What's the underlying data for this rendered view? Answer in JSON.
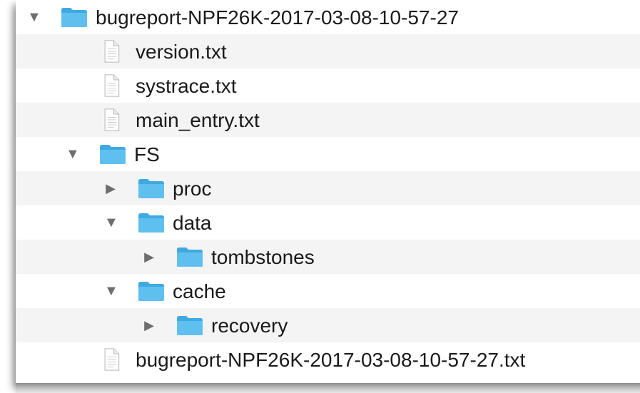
{
  "tree": {
    "root": {
      "label": "bugreport-NPF26K-2017-03-08-10-57-27",
      "icon": "folder-icon",
      "state": "expanded"
    },
    "items": [
      {
        "label": "version.txt",
        "icon": "text-file-icon"
      },
      {
        "label": "systrace.txt",
        "icon": "text-file-icon"
      },
      {
        "label": "main_entry.txt",
        "icon": "text-file-icon"
      },
      {
        "label": "FS",
        "icon": "folder-icon",
        "state": "expanded"
      },
      {
        "label": "proc",
        "icon": "folder-icon",
        "state": "collapsed"
      },
      {
        "label": "data",
        "icon": "folder-icon",
        "state": "expanded"
      },
      {
        "label": "tombstones",
        "icon": "folder-icon",
        "state": "collapsed"
      },
      {
        "label": "cache",
        "icon": "folder-icon",
        "state": "expanded"
      },
      {
        "label": "recovery",
        "icon": "folder-icon",
        "state": "collapsed"
      },
      {
        "label": "bugreport-NPF26K-2017-03-08-10-57-27.txt",
        "icon": "text-file-icon"
      }
    ]
  },
  "colors": {
    "folder": "#5fc0f0",
    "folder_dark": "#3fa9e0",
    "row_alt": "#f4f4f4",
    "disclosure": "#6e6e6e",
    "text": "#1a1a1a"
  }
}
